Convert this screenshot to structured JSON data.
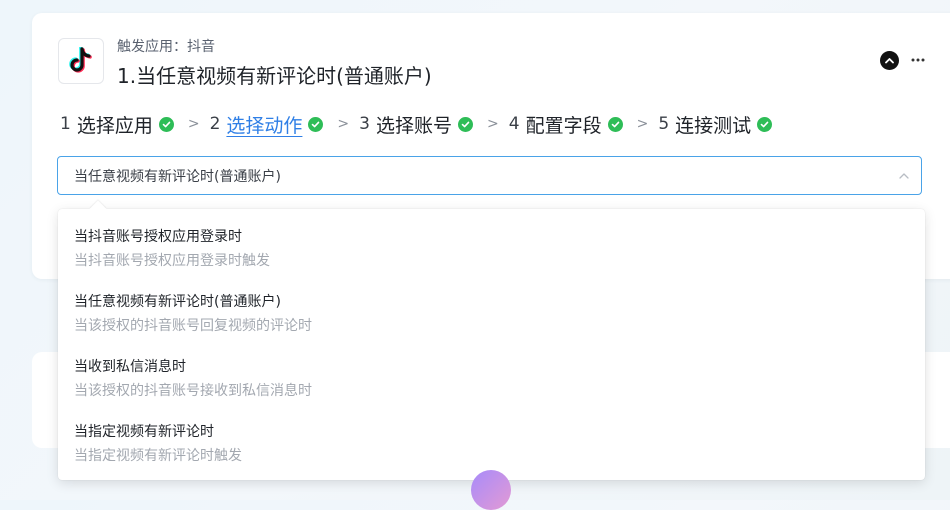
{
  "trigger": {
    "app_label": "触发应用：抖音",
    "title": "1.当任意视频有新评论时(普通账户)"
  },
  "icons": {
    "app": "tiktok-logo-icon",
    "collapse": "chevron-up-icon",
    "more": "more-horizontal-icon",
    "check": "check-circle-icon",
    "step_separator": "chevron-right-icon",
    "select_arrow": "chevron-up-icon"
  },
  "colors": {
    "accent": "#2f7fe6",
    "check": "#2ebd57",
    "select_border": "#4aa3e8"
  },
  "steps": [
    {
      "num": "1",
      "label": "选择应用",
      "active": false
    },
    {
      "num": "2",
      "label": "选择动作",
      "active": true
    },
    {
      "num": "3",
      "label": "选择账号",
      "active": false
    },
    {
      "num": "4",
      "label": "配置字段",
      "active": false
    },
    {
      "num": "5",
      "label": "连接测试",
      "active": false
    }
  ],
  "action_select": {
    "value": "当任意视频有新评论时(普通账户)"
  },
  "options": [
    {
      "title": "当抖音账号授权应用登录时",
      "desc": "当抖音账号授权应用登录时触发"
    },
    {
      "title": "当任意视频有新评论时(普通账户)",
      "desc": "当该授权的抖音账号回复视频的评论时"
    },
    {
      "title": "当收到私信消息时",
      "desc": "当该授权的抖音账号接收到私信消息时"
    },
    {
      "title": "当指定视频有新评论时",
      "desc": "当指定视频有新评论时触发"
    }
  ]
}
